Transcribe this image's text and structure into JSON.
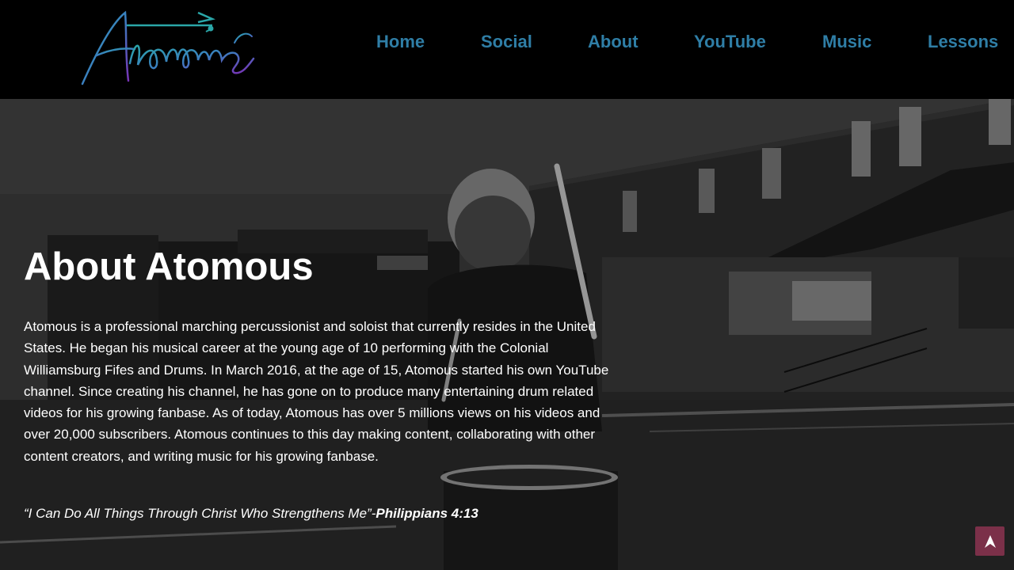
{
  "logo": {
    "text": "Atomous",
    "gradient_from": "#2aa6a8",
    "gradient_to": "#7a2fb5"
  },
  "nav": {
    "items": [
      {
        "label": "Home"
      },
      {
        "label": "Social"
      },
      {
        "label": "About"
      },
      {
        "label": "YouTube"
      },
      {
        "label": "Music"
      },
      {
        "label": "Lessons"
      }
    ],
    "color": "#2f7ea6"
  },
  "about": {
    "title": "About Atomous",
    "body": "Atomous is a professional marching percussionist and soloist that currently resides in the United States. He began his musical career at the young age of 10 performing with the Colonial Williamsburg Fifes and Drums. In March 2016, at the age of 15, Atomous started his own YouTube channel. Since creating his channel, he has gone on to produce many entertaining drum related videos for his growing fanbase. As of today, Atomous has over 5 millions views on his videos and over 20,000 subscribers. Atomous continues to this day making content, collaborating with other content creators, and writing music for his growing fanbase.",
    "quote": "“I Can Do All Things Through Christ Who Strengthens Me”-",
    "quote_ref": "Philippians 4:13"
  },
  "scroll_top": {
    "icon": "arrow-up-icon",
    "color": "#7b3049"
  }
}
